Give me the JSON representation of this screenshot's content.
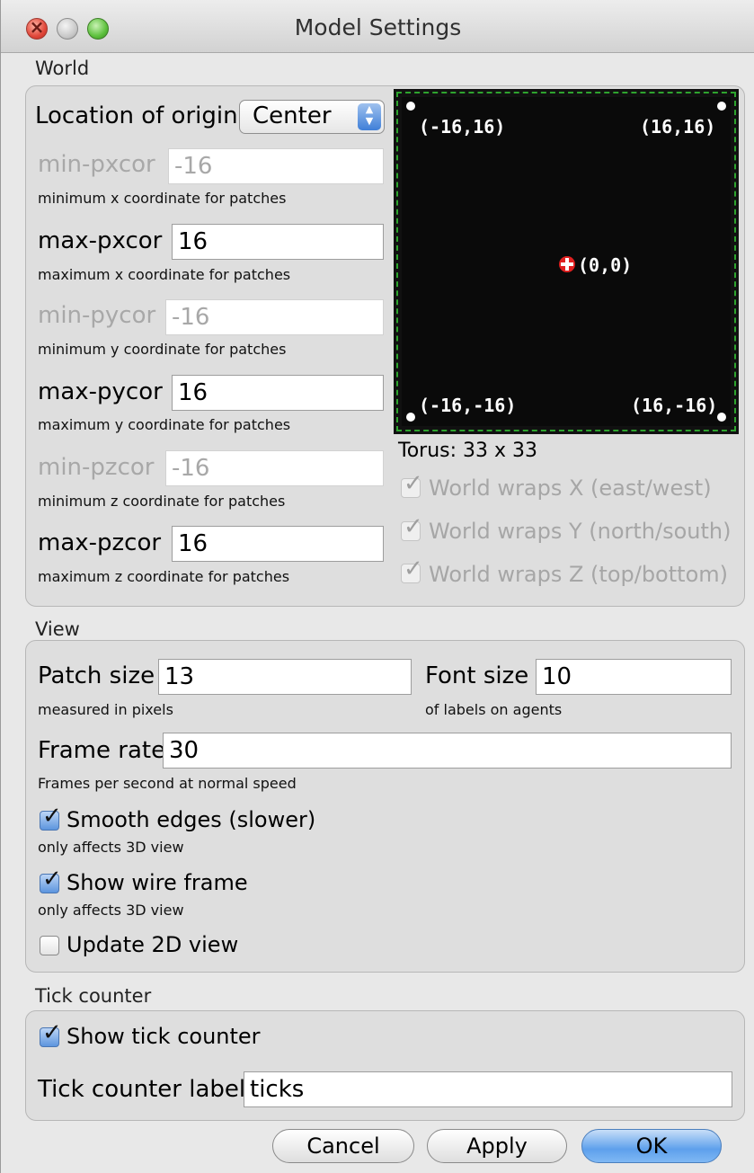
{
  "window": {
    "title": "Model Settings"
  },
  "world": {
    "section_label": "World",
    "origin": {
      "label": "Location of origin:",
      "value": "Center"
    },
    "fields": [
      {
        "name": "min-pxcor",
        "value": "-16",
        "hint": "minimum x coordinate for patches",
        "enabled": false
      },
      {
        "name": "max-pxcor",
        "value": "16",
        "hint": "maximum x coordinate for patches",
        "enabled": true
      },
      {
        "name": "min-pycor",
        "value": "-16",
        "hint": "minimum y coordinate for patches",
        "enabled": false
      },
      {
        "name": "max-pycor",
        "value": "16",
        "hint": "maximum y coordinate for patches",
        "enabled": true
      },
      {
        "name": "min-pzcor",
        "value": "-16",
        "hint": "minimum z coordinate for patches",
        "enabled": false
      },
      {
        "name": "max-pzcor",
        "value": "16",
        "hint": "maximum z coordinate for patches",
        "enabled": true
      }
    ],
    "preview": {
      "top_left": "(-16,16)",
      "top_right": "(16,16)",
      "center": "(0,0)",
      "bottom_left": "(-16,-16)",
      "bottom_right": "(16,-16)"
    },
    "torus": "Torus: 33 x 33",
    "wraps": [
      {
        "label": "World wraps X (east/west)",
        "checked": true
      },
      {
        "label": "World wraps Y (north/south)",
        "checked": true
      },
      {
        "label": "World wraps Z (top/bottom)",
        "checked": true
      }
    ]
  },
  "view": {
    "section_label": "View",
    "patch_size": {
      "label": "Patch size",
      "value": "13",
      "hint": "measured in pixels"
    },
    "font_size": {
      "label": "Font size",
      "value": "10",
      "hint": "of labels on agents"
    },
    "frame_rate": {
      "label": "Frame rate",
      "value": "30",
      "hint": "Frames per second at normal speed"
    },
    "smooth_edges": {
      "label": "Smooth edges (slower)",
      "hint": "only affects 3D view",
      "checked": true
    },
    "wire_frame": {
      "label": "Show wire frame",
      "hint": "only affects 3D view",
      "checked": true
    },
    "update_2d": {
      "label": "Update 2D view",
      "checked": false
    }
  },
  "tick": {
    "section_label": "Tick counter",
    "show": {
      "label": "Show tick counter",
      "checked": true
    },
    "label_field": {
      "label": "Tick counter label",
      "value": "ticks"
    }
  },
  "buttons": {
    "cancel": "Cancel",
    "apply": "Apply",
    "ok": "OK"
  },
  "colors": {
    "accent": "#5ea0ec",
    "grid_border": "#2ea42e",
    "origin_marker": "#e02020"
  }
}
